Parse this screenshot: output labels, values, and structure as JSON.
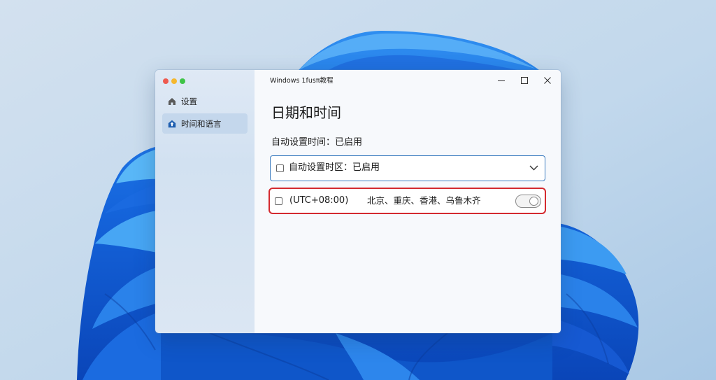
{
  "window": {
    "title": "Windows 1fusπ教程",
    "traffic_lights": {
      "close": "#ee5a4f",
      "minimize": "#f5b82e",
      "zoom": "#3ec447"
    },
    "controls": {
      "minimize_icon": "minimize-icon",
      "maximize_icon": "maximize-icon",
      "close_icon": "close-icon"
    }
  },
  "sidebar": {
    "items": [
      {
        "label": "设置",
        "icon": "home-icon",
        "selected": false
      },
      {
        "label": "时间和语言",
        "icon": "time-language-icon",
        "selected": true
      }
    ]
  },
  "main": {
    "heading": "日期和时间",
    "auto_time_status": "自动设置时间：已启用",
    "timezone_dropdown": {
      "label": "自动设置时区：已启用",
      "checked": false,
      "icon": "chevron-down-icon"
    },
    "timezone_row": {
      "utc_offset": "(UTC+08:00)",
      "cities": "北京、重庆、香港、乌鲁木齐",
      "checked": false,
      "toggle_on": true
    }
  },
  "colors": {
    "accent_border": "#3a7bbf",
    "highlight_border": "#d42a2f",
    "selected_item_bg": "#c4d7ec",
    "wallpaper_bloom": "#1565dc"
  }
}
